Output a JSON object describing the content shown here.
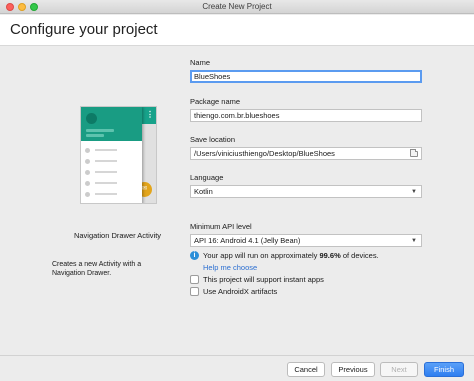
{
  "window": {
    "title": "Create New Project"
  },
  "header": {
    "title": "Configure your project"
  },
  "template": {
    "name": "Navigation Drawer Activity",
    "description": "Creates a new Activity with a Navigation Drawer."
  },
  "form": {
    "name": {
      "label": "Name",
      "value": "BlueShoes"
    },
    "package": {
      "label": "Package name",
      "value": "thiengo.com.br.blueshoes"
    },
    "save_location": {
      "label": "Save location",
      "value": "/Users/viniciusthiengo/Desktop/BlueShoes"
    },
    "language": {
      "label": "Language",
      "value": "Kotlin"
    },
    "min_api": {
      "label": "Minimum API level",
      "value": "API 16: Android 4.1 (Jelly Bean)"
    },
    "info": {
      "prefix": "Your app will run on approximately ",
      "percent": "99.6%",
      "suffix": " of devices."
    },
    "help_link": "Help me choose",
    "instant_apps": {
      "label": "This project will support instant apps",
      "checked": false
    },
    "androidx": {
      "label": "Use AndroidX artifacts",
      "checked": false
    }
  },
  "footer": {
    "cancel": "Cancel",
    "previous": "Previous",
    "next": "Next",
    "finish": "Finish"
  },
  "colors": {
    "accent": "#2e7ef0",
    "preview_teal": "#17a28a",
    "fab": "#e3a51b"
  },
  "icons": {
    "overflow": "more-vertical-icon",
    "folder": "folder-icon",
    "info": "info-icon",
    "dropdown": "chevron-down-icon"
  }
}
